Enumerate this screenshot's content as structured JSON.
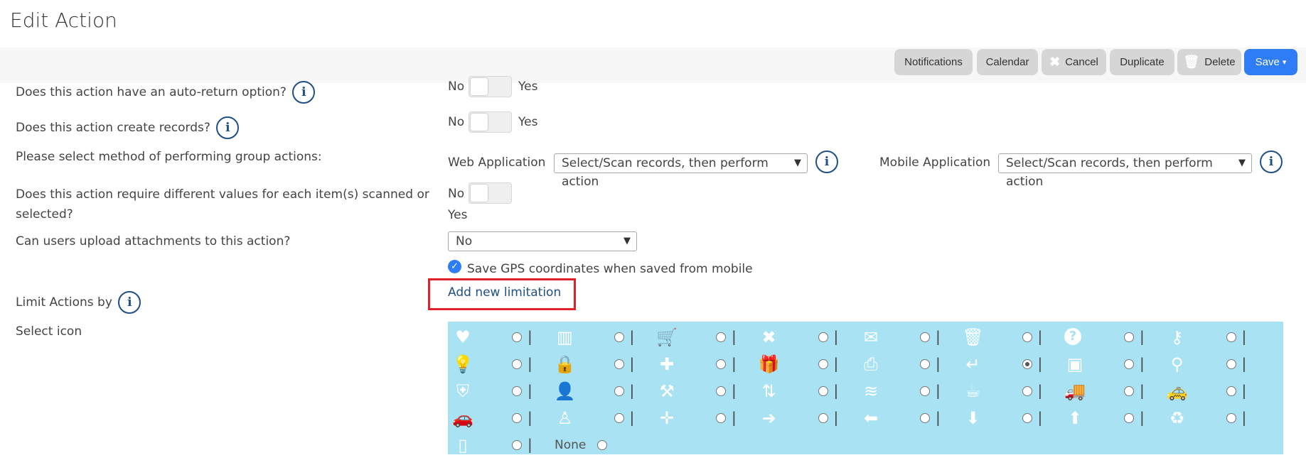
{
  "header": {
    "title": "Edit Action"
  },
  "toolbar": {
    "notifications": "Notifications",
    "calendar": "Calendar",
    "cancel": "Cancel",
    "duplicate": "Duplicate",
    "delete": "Delete",
    "save": "Save"
  },
  "form": {
    "auto_return": {
      "label": "Does this action have an auto-return option?",
      "no": "No",
      "yes": "Yes"
    },
    "create_records": {
      "label": "Does this action create records?",
      "no": "No",
      "yes": "Yes"
    },
    "group_method": {
      "label": "Please select method of performing group actions:",
      "web_label": "Web Application",
      "web_value": "Select/Scan records, then perform action",
      "mobile_label": "Mobile Application",
      "mobile_value": "Select/Scan records, then perform action"
    },
    "different_values": {
      "label_line1": "Does this action require different values for each item(s) scanned or",
      "label_line2": "selected?",
      "no": "No",
      "yes": "Yes"
    },
    "attachments": {
      "label": "Can users upload attachments to this action?",
      "value": "No"
    },
    "gps": {
      "label": "Save GPS coordinates when saved from mobile",
      "checked": true
    },
    "limit": {
      "label": "Limit Actions by",
      "link": "Add new limitation"
    },
    "select_icon": {
      "label": "Select icon",
      "none_label": "None",
      "selected": "return-icon",
      "icons": [
        [
          "heart-icon",
          "barcode-icon",
          "cart-icon",
          "close-icon",
          "envelope-icon",
          "trash-icon",
          "question-icon",
          "key-icon"
        ],
        [
          "lightbulb-icon",
          "lock-icon",
          "plus-icon",
          "gift-icon",
          "printer-icon",
          "return-icon",
          "save-icon",
          "search-icon"
        ],
        [
          "shield-icon",
          "user-icon",
          "tools-icon",
          "sort-icon",
          "layers-icon",
          "cup-icon",
          "truck-icon",
          "taxi-icon"
        ],
        [
          "car-icon",
          "person-icon",
          "move-icon",
          "arrow-right-icon",
          "arrow-left-icon",
          "arrow-down-icon",
          "arrow-up-icon",
          "bin-icon"
        ],
        [
          "tablet-icon"
        ]
      ]
    }
  },
  "colors": {
    "accent": "#2f7df6",
    "panel": "#a8e2f3",
    "info": "#1f4f86",
    "highlight": "#e0202a"
  }
}
